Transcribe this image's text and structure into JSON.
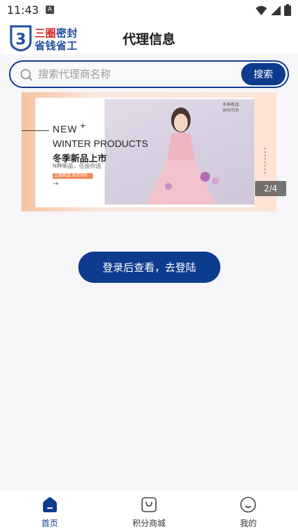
{
  "status": {
    "time": "11:43",
    "notification_glyph": "A"
  },
  "header": {
    "title": "代理信息",
    "logo": {
      "line1_red": "三圈",
      "line1_blue": "密封",
      "line2": "省钱省工",
      "badge_digit": "3"
    }
  },
  "search": {
    "placeholder": "搜索代理商名称",
    "value": "",
    "button_label": "搜索"
  },
  "banner": {
    "headline_new": "NEW",
    "headline_plus": "+",
    "headline_winter": "WINTER PRODUCTS",
    "headline_cn": "冬季新品上市",
    "subtitle": "N种新品，任由你选",
    "tag": "上架新品 折扣X折",
    "arrow": "→",
    "photo_text_line1": "冬季新品",
    "photo_text_line2": "WINTER",
    "counter": "2/4",
    "current": 2,
    "total": 4
  },
  "login_button": {
    "label": "登录后查看，去登陆"
  },
  "tabbar": {
    "items": [
      {
        "label": "首页",
        "icon": "home-icon",
        "active": true
      },
      {
        "label": "积分商城",
        "icon": "shopping-bag-icon",
        "active": false
      },
      {
        "label": "我的",
        "icon": "smiley-icon",
        "active": false
      }
    ]
  },
  "colors": {
    "primary": "#0d3b8e",
    "logo_red": "#d42222",
    "tag_orange": "#f28a56"
  }
}
